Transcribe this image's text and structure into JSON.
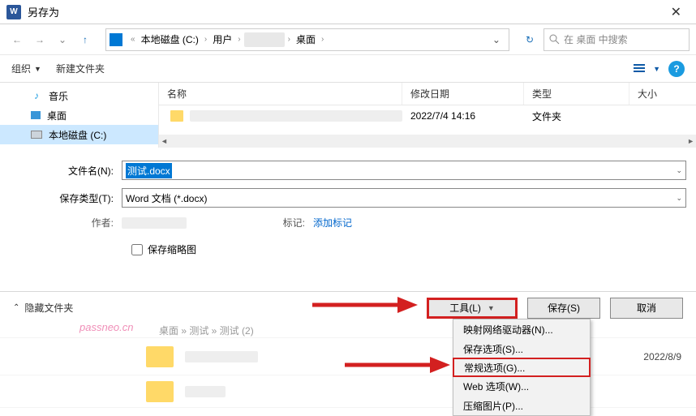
{
  "titlebar": {
    "app_icon": "W",
    "title": "另存为"
  },
  "nav": {
    "breadcrumb": [
      "本地磁盘 (C:)",
      "用户",
      "",
      "桌面"
    ],
    "search_placeholder": "在 桌面 中搜索"
  },
  "toolbar": {
    "organize": "组织",
    "new_folder": "新建文件夹"
  },
  "sidebar": {
    "items": [
      {
        "icon": "music",
        "label": "音乐"
      },
      {
        "icon": "desktop",
        "label": "桌面"
      },
      {
        "icon": "disk",
        "label": "本地磁盘 (C:)"
      }
    ]
  },
  "columns": {
    "name": "名称",
    "date": "修改日期",
    "type": "类型",
    "size": "大小"
  },
  "filelist": {
    "rows": [
      {
        "name": "",
        "date": "2022/7/4 14:16",
        "type": "文件夹"
      }
    ]
  },
  "form": {
    "filename_label": "文件名(N):",
    "filename_value": "测试.docx",
    "savetype_label": "保存类型(T):",
    "savetype_value": "Word 文档 (*.docx)",
    "author_label": "作者:",
    "tags_label": "标记:",
    "tags_value": "添加标记",
    "thumbnail_label": "保存缩略图"
  },
  "footer": {
    "hide_folders": "隐藏文件夹",
    "tools": "工具(L)",
    "save": "保存(S)",
    "cancel": "取消"
  },
  "menu": {
    "items": [
      "映射网络驱动器(N)...",
      "保存选项(S)...",
      "常规选项(G)...",
      "Web 选项(W)...",
      "压缩图片(P)..."
    ]
  },
  "background": {
    "path_fragment": "桌面 » 测试 » 测试 (2)",
    "row_date": "2022/8/9"
  },
  "watermark": "passneo.cn"
}
